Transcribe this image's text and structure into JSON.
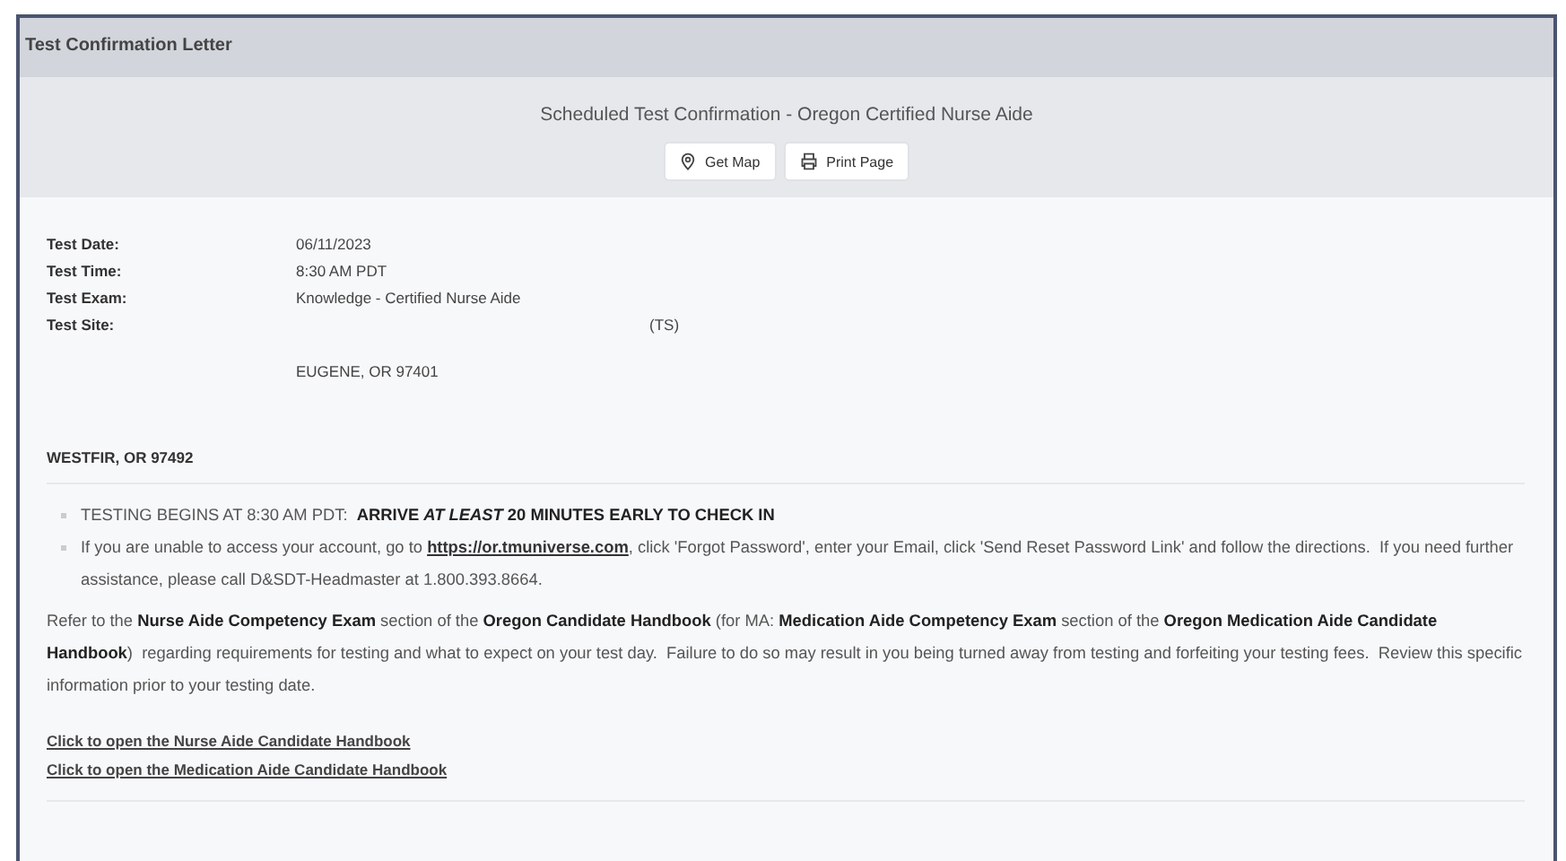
{
  "window": {
    "title": "Test Confirmation Letter"
  },
  "heading": "Scheduled Test Confirmation - Oregon Certified Nurse Aide",
  "buttons": [
    {
      "label": "Get Map",
      "kind": "map"
    },
    {
      "label": "Print Page",
      "kind": "print"
    }
  ],
  "details": [
    {
      "label": "Test Date:",
      "value": "06/11/2023"
    },
    {
      "label": "Test Time:",
      "value": "8:30 AM PDT"
    },
    {
      "label": "Test Exam:",
      "value": "Knowledge - Certified Nurse Aide"
    },
    {
      "label": "Test Site:",
      "value": "(TS)"
    }
  ],
  "site_address": "EUGENE, OR 97401",
  "candidate_address": "WESTFIR, OR 97492",
  "notices": [
    {
      "before": "TESTING BEGINS AT 8:30 AM PDT:  **ARRIVE *AT LEAST* 20 MINUTES EARLY TO CHECK IN**"
    },
    {
      "before": "If you are unable to access your account, go to ",
      "link": "https://or.tmuniverse.com",
      "after": ", click 'Forgot Password', enter your Email, click 'Send Reset Password Link' and follow the directions.  If you need further assistance, please call D&SDT-Headmaster at 1.800.393.8664."
    }
  ],
  "paragraph": "Refer to the **Nurse Aide Competency Exam** section of the **Oregon Candidate Handbook** (for MA: **Medication Aide Competency Exam** section of the **Oregon Medication Aide Candidate Handbook**)  regarding requirements for testing and what to expect on your test day.  Failure to do so may result in you being turned away from testing and forfeiting your testing fees.  Review this specific information prior to your testing date.",
  "links": [
    "Click to open the Nurse Aide Candidate Handbook",
    "Click to open the Medication Aide Candidate Handbook"
  ]
}
